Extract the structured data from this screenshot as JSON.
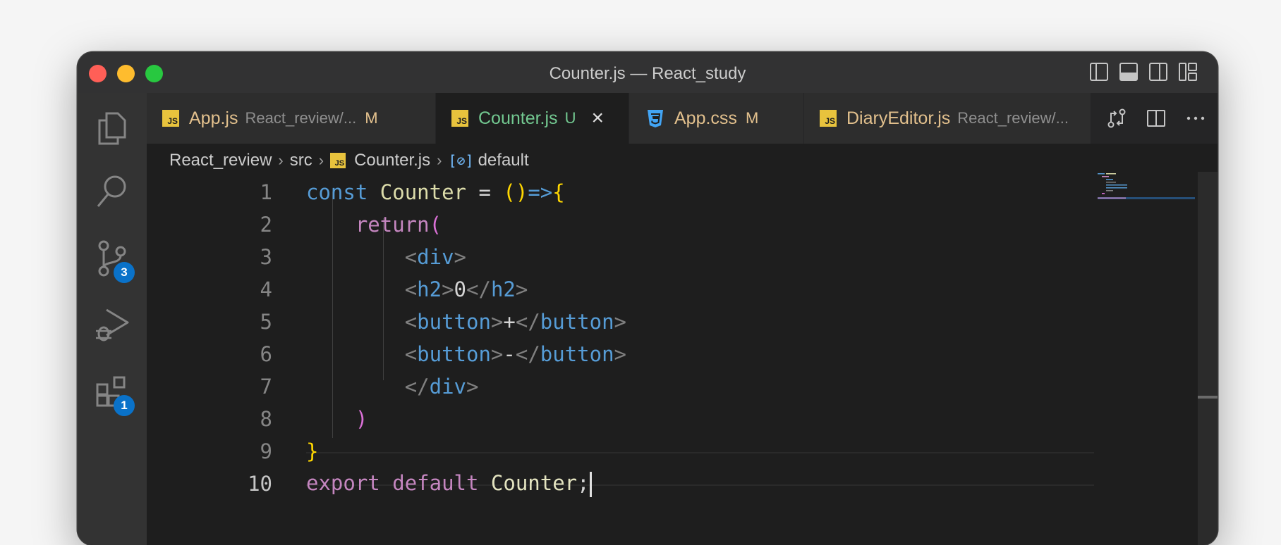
{
  "window": {
    "title": "Counter.js — React_study"
  },
  "activity_bar": {
    "items": [
      {
        "name": "explorer",
        "icon": "files-icon"
      },
      {
        "name": "search",
        "icon": "search-icon"
      },
      {
        "name": "source-control",
        "icon": "source-control-icon",
        "badge": "3"
      },
      {
        "name": "run-debug",
        "icon": "run-debug-icon"
      },
      {
        "name": "extensions",
        "icon": "extensions-icon",
        "badge": "1"
      }
    ]
  },
  "tabs": [
    {
      "name": "App.js",
      "path": "React_review/...",
      "status": "M",
      "icon": "js",
      "active": false
    },
    {
      "name": "Counter.js",
      "path": "",
      "status": "U",
      "icon": "js",
      "active": true,
      "close": "×"
    },
    {
      "name": "App.css",
      "path": "",
      "status": "M",
      "icon": "css",
      "active": false
    },
    {
      "name": "DiaryEditor.js",
      "path": "React_review/...",
      "status": "",
      "icon": "js",
      "active": false
    }
  ],
  "tab_actions": [
    "open-changes-icon",
    "split-editor-icon",
    "more-actions-icon"
  ],
  "breadcrumb": {
    "items": [
      "React_review",
      "src",
      "Counter.js",
      "default"
    ],
    "file_icon": "JS",
    "symbol_icon": "[⊘]"
  },
  "editor": {
    "current_line": "10",
    "lines": [
      {
        "n": "1",
        "tokens": [
          [
            "kw",
            "const"
          ],
          [
            "txt",
            " "
          ],
          [
            "var",
            "Counter"
          ],
          [
            "txt",
            " = "
          ],
          [
            "brace1",
            "()"
          ],
          [
            "kw",
            "=>"
          ],
          [
            "brace1",
            "{"
          ]
        ]
      },
      {
        "n": "2",
        "tokens": [
          [
            "txt",
            "    "
          ],
          [
            "ctl",
            "return"
          ],
          [
            "brace2",
            "("
          ]
        ]
      },
      {
        "n": "3",
        "tokens": [
          [
            "txt",
            "        "
          ],
          [
            "tagp",
            "<"
          ],
          [
            "tag",
            "div"
          ],
          [
            "tagp",
            ">"
          ]
        ]
      },
      {
        "n": "4",
        "tokens": [
          [
            "txt",
            "        "
          ],
          [
            "tagp",
            "<"
          ],
          [
            "tag",
            "h2"
          ],
          [
            "tagp",
            ">"
          ],
          [
            "txt",
            "0"
          ],
          [
            "tagp",
            "</"
          ],
          [
            "tag",
            "h2"
          ],
          [
            "tagp",
            ">"
          ]
        ]
      },
      {
        "n": "5",
        "tokens": [
          [
            "txt",
            "        "
          ],
          [
            "tagp",
            "<"
          ],
          [
            "tag",
            "button"
          ],
          [
            "tagp",
            ">"
          ],
          [
            "txt",
            "+"
          ],
          [
            "tagp",
            "</"
          ],
          [
            "tag",
            "button"
          ],
          [
            "tagp",
            ">"
          ]
        ]
      },
      {
        "n": "6",
        "tokens": [
          [
            "txt",
            "        "
          ],
          [
            "tagp",
            "<"
          ],
          [
            "tag",
            "button"
          ],
          [
            "tagp",
            ">"
          ],
          [
            "txt",
            "-"
          ],
          [
            "tagp",
            "</"
          ],
          [
            "tag",
            "button"
          ],
          [
            "tagp",
            ">"
          ]
        ]
      },
      {
        "n": "7",
        "tokens": [
          [
            "txt",
            "        "
          ],
          [
            "tagp",
            "</"
          ],
          [
            "tag",
            "div"
          ],
          [
            "tagp",
            ">"
          ]
        ]
      },
      {
        "n": "8",
        "tokens": [
          [
            "txt",
            "    "
          ],
          [
            "brace2",
            ")"
          ]
        ]
      },
      {
        "n": "9",
        "tokens": [
          [
            "brace1",
            "}"
          ]
        ]
      },
      {
        "n": "10",
        "tokens": [
          [
            "ctl",
            "export"
          ],
          [
            "txt",
            " "
          ],
          [
            "ctl",
            "default"
          ],
          [
            "txt",
            " "
          ],
          [
            "ident",
            "Counter"
          ],
          [
            "txt",
            ";"
          ]
        ]
      }
    ]
  },
  "colors": {
    "keyword": "#569cd6",
    "control": "#c586c0",
    "function": "#dcdcaa",
    "bracket_gold": "#ffd700",
    "bracket_pink": "#da70d6",
    "modified": "#e2c08d",
    "untracked": "#73c991",
    "badge": "#0a72c9"
  }
}
